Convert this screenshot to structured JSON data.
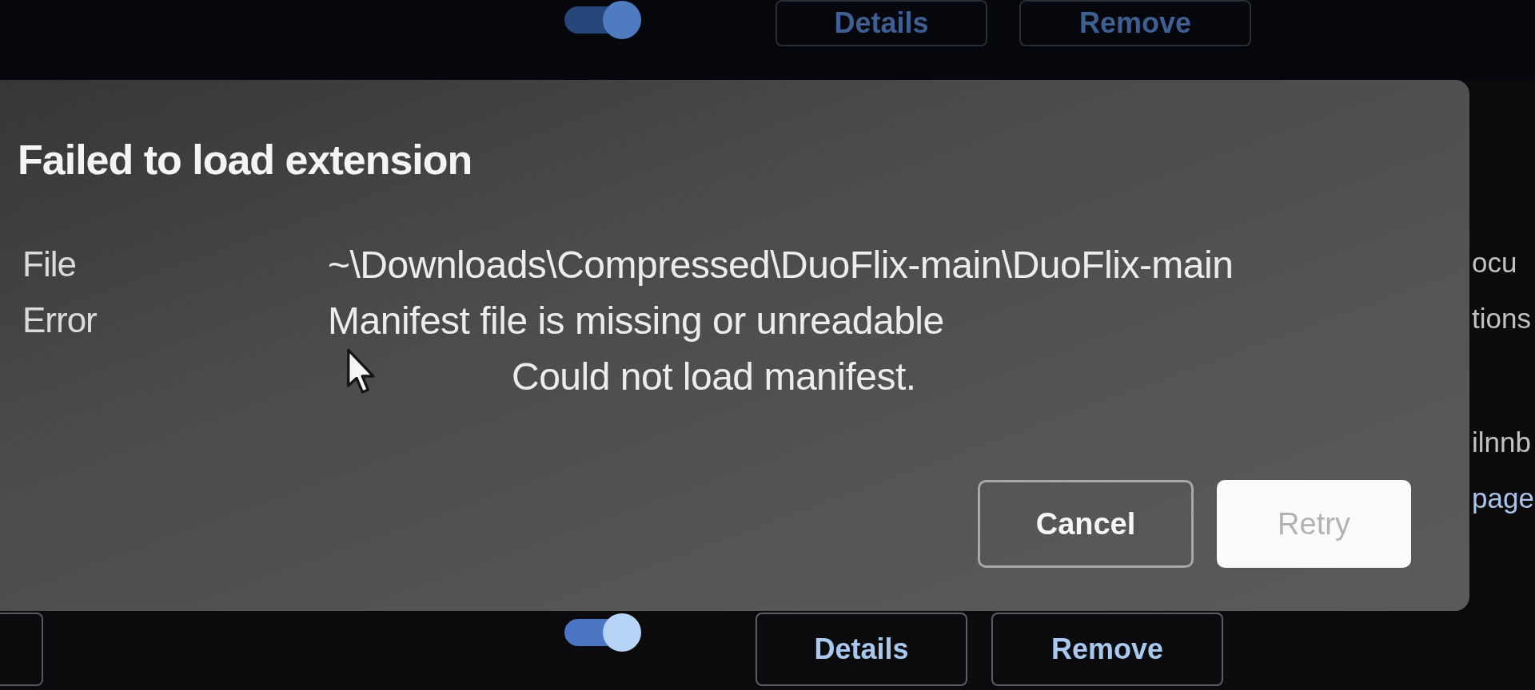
{
  "background_top": {
    "toggle": {
      "on": true
    },
    "buttons": [
      "Details",
      "Remove"
    ]
  },
  "dialog": {
    "title": "Failed to load extension",
    "fields": [
      {
        "label": "File",
        "value": "~\\Downloads\\Compressed\\DuoFlix-main\\DuoFlix-main"
      },
      {
        "label": "Error",
        "value": "Manifest file is missing or unreadable",
        "detail": "Could not load manifest."
      }
    ],
    "buttons": [
      {
        "label": "Cancel",
        "kind": "secondary"
      },
      {
        "label": "Retry",
        "kind": "primary"
      }
    ]
  },
  "background_side": [
    {
      "text": "ocu",
      "kind": "text"
    },
    {
      "text": "tions",
      "kind": "text"
    },
    {
      "text": "ilnnb",
      "kind": "text"
    },
    {
      "text": "page",
      "kind": "link"
    }
  ],
  "background_bottom": {
    "toggle": {
      "on": true
    },
    "buttons": [
      "Details",
      "Remove"
    ]
  }
}
